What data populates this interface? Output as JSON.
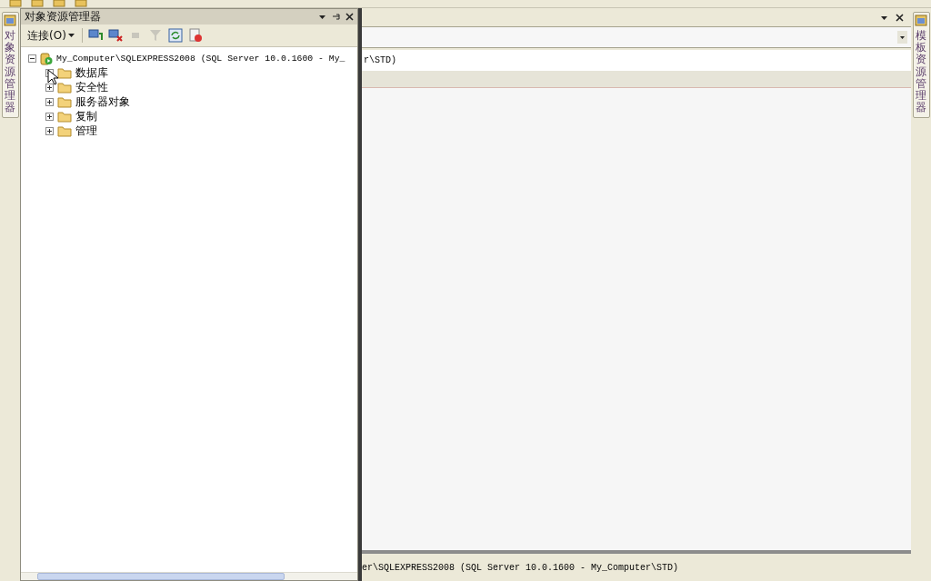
{
  "left_sidebar": {
    "tab": "对象资源管理器"
  },
  "object_explorer": {
    "title": "对象资源管理器",
    "connect_label": "连接(O)",
    "tree": [
      {
        "label": "My_Computer\\SQLEXPRESS2008 (SQL Server 10.0.1600 - My_",
        "kind": "server",
        "expanded": true,
        "children": [
          {
            "label": "数据库",
            "kind": "folder",
            "expanded": false
          },
          {
            "label": "安全性",
            "kind": "folder",
            "expanded": false
          },
          {
            "label": "服务器对象",
            "kind": "folder",
            "expanded": false
          },
          {
            "label": "复制",
            "kind": "folder",
            "expanded": false
          },
          {
            "label": "管理",
            "kind": "folder",
            "expanded": false
          }
        ]
      }
    ]
  },
  "document": {
    "connection_line": "r\\STD)",
    "status_text": "er\\SQLEXPRESS2008 (SQL Server 10.0.1600 - My_Computer\\STD)"
  },
  "right_sidebar": {
    "tab": "模板资源管理器"
  }
}
